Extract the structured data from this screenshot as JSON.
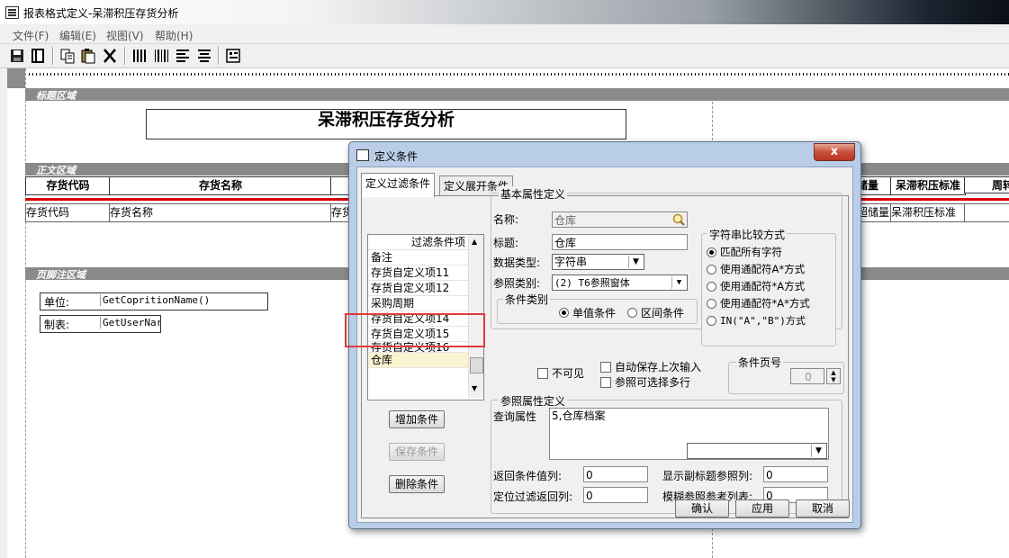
{
  "window": {
    "title": "报表格式定义-呆滞积压存货分析"
  },
  "menu": [
    "文件(F)",
    "编辑(E)",
    "视图(V)",
    "帮助(H)"
  ],
  "report": {
    "title_band": "标题区域",
    "report_title": "呆滞积压存货分析",
    "body_band": "正文区域",
    "col_headers_left": [
      "存货代码",
      "存货名称"
    ],
    "col_headers_right": [
      "储量",
      "呆滞积压标准",
      "周转"
    ],
    "row_left": [
      "存货代码",
      "存货名称",
      "存货"
    ],
    "row_right": [
      "超储量",
      "呆滞积压标准"
    ],
    "footer_band": "页脚注区域",
    "unit_label": "单位:",
    "unit_value": "GetCopritionName()",
    "maker_label": "制表:",
    "maker_value": "GetUserNar"
  },
  "dialog": {
    "title": "定义条件",
    "close": "x",
    "tabs": [
      "定义过滤条件",
      "定义展开条件"
    ],
    "list_header": "过滤条件项",
    "list_items": [
      "备注",
      "存货自定义项11",
      "存货自定义项12",
      "采购周期",
      "存货自定义项14",
      "存货自定义项15",
      "存货自定义项16",
      "仓库"
    ],
    "buttons": {
      "add": "增加条件",
      "save": "保存条件",
      "delete": "删除条件",
      "ok": "确认",
      "apply": "应用",
      "cancel": "取消"
    },
    "basic": {
      "group": "基本属性定义",
      "name_label": "名称:",
      "name_value": "仓库",
      "title_label": "标题:",
      "title_value": "仓库",
      "datatype_label": "数据类型:",
      "datatype_value": "字符串",
      "reftype_label": "参照类别:",
      "reftype_value": "(2) T6参照窗体",
      "condtype_group": "条件类别",
      "cond_options": [
        "单值条件",
        "区间条件"
      ]
    },
    "compare": {
      "group": "字符串比较方式",
      "options": [
        "匹配所有字符",
        "使用通配符A*方式",
        "使用通配符*A方式",
        "使用通配符*A*方式",
        "IN(\"A\",\"B\")方式"
      ]
    },
    "checks": {
      "invisible": "不可见",
      "autosave": "自动保存上次输入",
      "multiselect": "参照可选择多行"
    },
    "page": {
      "label": "条件页号",
      "value": "0"
    },
    "ref": {
      "group": "参照属性定义",
      "query_label": "查询属性",
      "query_value": "5,仓库档案",
      "return_col_label": "返回条件值列:",
      "return_col_value": "0",
      "subtitle_col_label": "显示副标题参照列:",
      "subtitle_col_value": "0",
      "locate_col_label": "定位过滤返回列:",
      "locate_col_value": "0",
      "fuzzy_col_label": "模糊参照参考列表:",
      "fuzzy_col_value": "0"
    }
  }
}
